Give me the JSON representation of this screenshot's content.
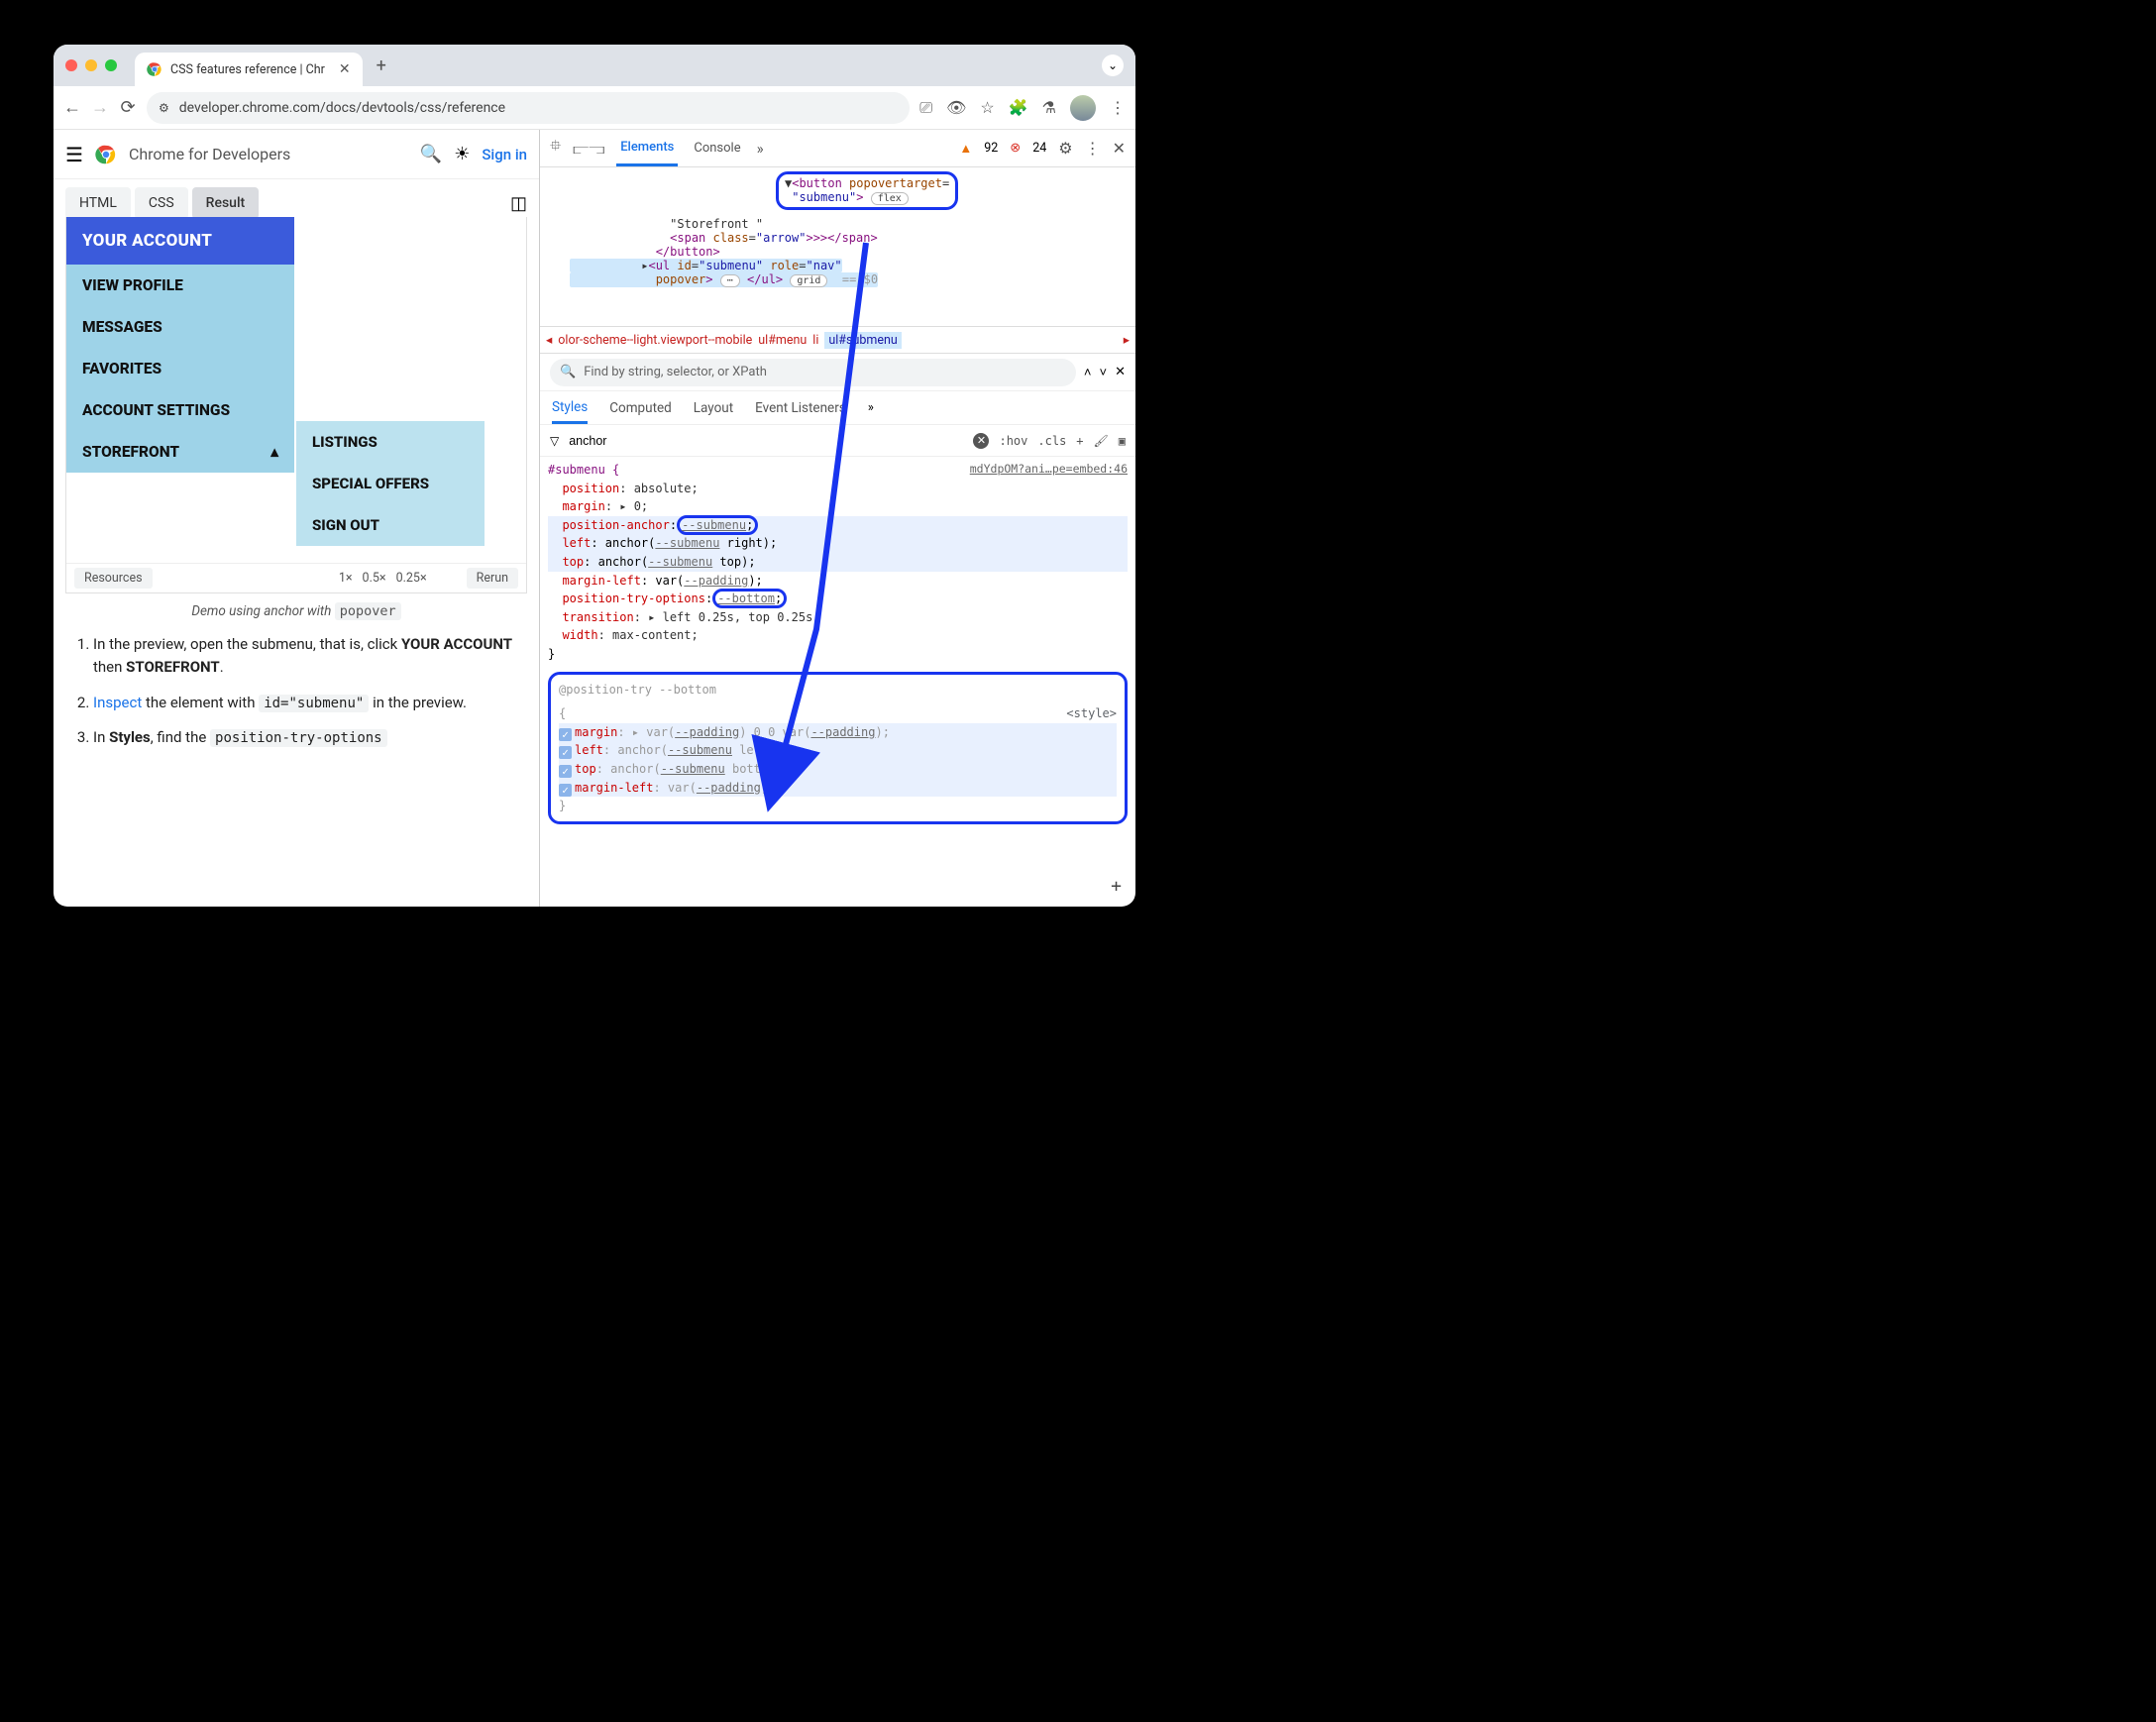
{
  "browser": {
    "tab_title": "CSS features reference | Chr",
    "url": "developer.chrome.com/docs/devtools/css/reference"
  },
  "page": {
    "brand": "Chrome for Developers",
    "signin": "Sign in",
    "code_tabs": {
      "html": "HTML",
      "css": "CSS",
      "result": "Result"
    },
    "menu": {
      "header": "YOUR ACCOUNT",
      "items": [
        "VIEW PROFILE",
        "MESSAGES",
        "FAVORITES",
        "ACCOUNT SETTINGS",
        "STOREFRONT"
      ],
      "submenu": [
        "LISTINGS",
        "SPECIAL OFFERS",
        "SIGN OUT"
      ]
    },
    "controls": {
      "resources": "Resources",
      "z1": "1×",
      "z05": "0.5×",
      "z025": "0.25×",
      "rerun": "Rerun"
    },
    "caption_pre": "Demo using anchor with ",
    "caption_code": "popover",
    "steps": {
      "s1a": "In the preview, open the submenu, that is, click ",
      "s1b": "YOUR ACCOUNT",
      "s1c": " then ",
      "s1d": "STOREFRONT",
      "s1e": ".",
      "s2a": "Inspect",
      "s2b": " the element with ",
      "s2code": "id=\"submenu\"",
      "s2c": " in the preview.",
      "s3a": "In ",
      "s3b": "Styles",
      "s3c": ", find the ",
      "s3code": "position-try-options"
    }
  },
  "devtools": {
    "tabs": {
      "elements": "Elements",
      "console": "Console"
    },
    "warns": "92",
    "errs": "24",
    "html": {
      "l1a": "<button",
      "l1b": "popovertarget",
      "l1c": "=",
      "l2a": "\"submenu\"",
      "l2b": ">",
      "flex": "flex",
      "l3": "\"Storefront \"",
      "l4a": "<span",
      "l4b": "class",
      "l4c": "\"arrow\"",
      "l4d": "></span>",
      "l5": "</button>",
      "l6a": "<ul",
      "l6b": "id",
      "l6c": "\"submenu\"",
      "l6d": "role",
      "l6e": "\"nav\"",
      "l7a": "popover",
      "l7b": ">",
      "dots": "⋯",
      "l7c": "</ul>",
      "grid": "grid",
      "eq": "== $0"
    },
    "crumbs": {
      "c1": "olor-scheme--light.viewport--mobile",
      "c2": "ul#menu",
      "c3": "li",
      "c4": "ul#submenu"
    },
    "find_placeholder": "Find by string, selector, or XPath",
    "styles_tabs": {
      "styles": "Styles",
      "computed": "Computed",
      "layout": "Layout",
      "listeners": "Event Listeners"
    },
    "filter": "anchor",
    "hov": ":hov",
    "cls": ".cls",
    "rule": {
      "selector": "#submenu {",
      "src": "mdYdpOM?ani…pe=embed:46",
      "p1": "position",
      "v1": ": absolute;",
      "p2": "margin",
      "v2": ": ▸ 0;",
      "p3": "position-anchor",
      "v3a": ":",
      "v3b": "--submenu",
      "v3c": ";",
      "p4": "left",
      "v4": ": anchor(",
      "v4b": "--submenu",
      "v4c": " right);",
      "p5": "top",
      "v5": ": anchor(",
      "v5b": "--submenu",
      "v5c": " top);",
      "p6": "margin-left",
      "v6": ": var(",
      "v6b": "--padding",
      "v6c": ");",
      "p7": "position-try-options",
      "v7a": ":",
      "v7b": "--bottom",
      "v7c": ";",
      "p8": "transition",
      "v8": ": ▸ left 0.25s, top 0.25s;",
      "p9": "width",
      "v9": ": max-content;",
      "close": "}"
    },
    "try": {
      "header": "@position-try --bottom",
      "open": "{",
      "m": "margin",
      "mv": ": ▸ var(",
      "mv2": "--padding",
      "mv3": ") 0 0 var(",
      "mv4": "--padding",
      "mv5": ");",
      "l": "left",
      "lv": ": anchor(",
      "lv2": "--submenu",
      "lv3": " left);",
      "t": "top",
      "tv": ": anchor(",
      "tv2": "--submenu",
      "tv3": " bottom);",
      "ml": "margin-left",
      "mlv": ": var(",
      "mlv2": "--padding",
      "mlv3": ");",
      "close": "}",
      "src": "<style>"
    }
  }
}
